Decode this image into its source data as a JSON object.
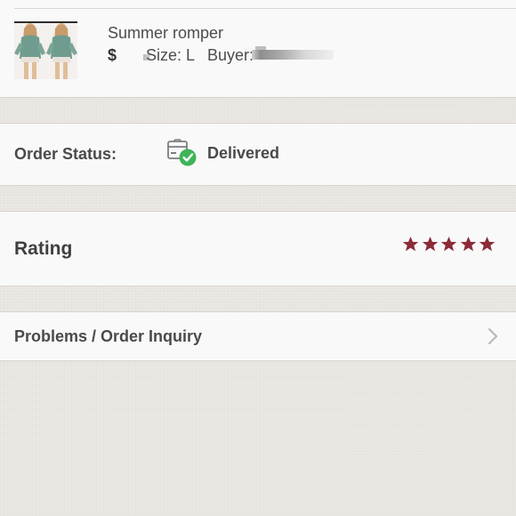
{
  "product": {
    "title": "Summer romper",
    "price_symbol": "$",
    "size_text": "Size: L",
    "buyer_label": "Buyer:"
  },
  "order_status": {
    "label": "Order Status:",
    "value": "Delivered",
    "icon": "delivered-box-icon",
    "icon_check_color": "#3fb35a"
  },
  "rating": {
    "label": "Rating",
    "stars": 5,
    "max_stars": 5,
    "star_color": "#8b2b37"
  },
  "problems": {
    "label": "Problems / Order Inquiry",
    "icon": "chevron-right-icon"
  }
}
